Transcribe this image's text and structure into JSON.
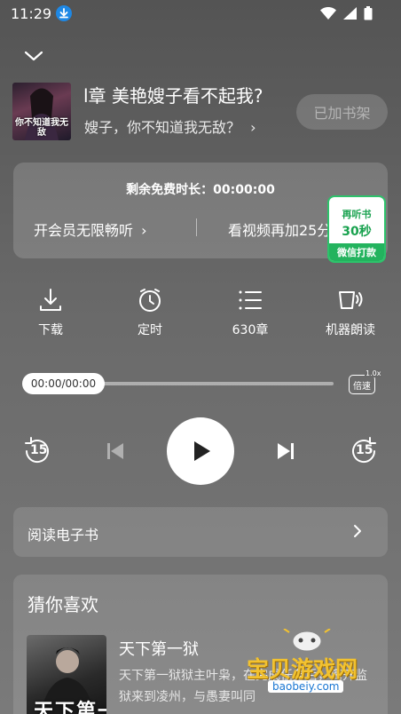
{
  "status_bar": {
    "time": "11:29"
  },
  "book": {
    "cover_text": "你不知道我无敌",
    "chapter_title": "l章 美艳嫂子看不起我?",
    "subtitle": "嫂子，你不知道我无敌？",
    "subtitle_arrow": "›",
    "shelf_button": "已加书架"
  },
  "free_card": {
    "remaining_label": "剩余免费时长：00:00:00",
    "vip_link": "开会员无限畅听",
    "vip_arrow": "›",
    "video_link": "看视频再加25分",
    "listen_badge": {
      "line1": "再听书",
      "line2": "30秒",
      "footer": "微信打款"
    }
  },
  "toolbar": [
    {
      "label": "下载",
      "icon": "download-icon"
    },
    {
      "label": "定时",
      "icon": "timer-icon"
    },
    {
      "label": "630章",
      "icon": "chapter-list-icon"
    },
    {
      "label": "机器朗读",
      "icon": "machine-read-icon"
    }
  ],
  "player": {
    "time": "00:00/00:00",
    "progress": 0,
    "speed_label": "倍速",
    "speed_value": "1.0x",
    "rewind_label": "15",
    "forward_label": "15"
  },
  "ebook": {
    "label": "阅读电子书",
    "arrow": "›"
  },
  "recommend": {
    "title": "猜你喜欢",
    "book": {
      "cover_text": "天下第一狱",
      "title": "天下第一狱",
      "description": "天下第一狱狱主叶枭，在完成任务后，离开监狱来到凌州，与愚妻叫同"
    }
  },
  "watermark": {
    "text": "宝贝游戏网",
    "url": "baobeiy.com"
  },
  "colors": {
    "badge_green": "#2dc26b",
    "accent_blue": "#1e88e5",
    "watermark_gold": "#f2c230"
  }
}
